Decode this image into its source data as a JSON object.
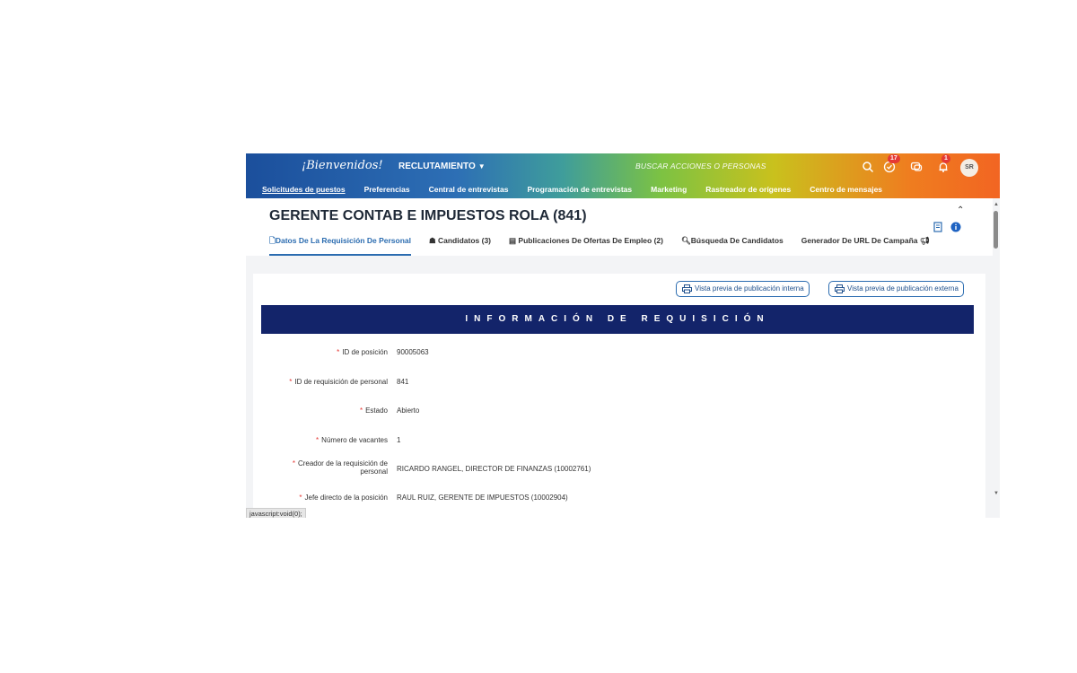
{
  "header": {
    "logo_text": "¡Bienvenidos!",
    "module": "RECLUTAMIENTO",
    "search_placeholder": "BUSCAR ACCIONES O PERSONAS",
    "todo_badge": "17",
    "notifications_badge": "1",
    "avatar": "SR"
  },
  "nav": {
    "items": [
      "Solicitudes de puestos",
      "Preferencias",
      "Central de entrevistas",
      "Programación de entrevistas",
      "Marketing",
      "Rastreador de orígenes",
      "Centro de mensajes"
    ]
  },
  "page": {
    "title": "GERENTE CONTAB E IMPUESTOS ROLA (841)",
    "tabs": [
      "Datos De La Requisición De Personal",
      "Candidatos (3)",
      "Publicaciones De Ofertas De Empleo (2)",
      "Búsqueda De Candidatos",
      "Generador De URL De Campaña"
    ]
  },
  "buttons": {
    "internal_preview": "Vista previa de publicación interna",
    "external_preview": "Vista previa de publicación externa"
  },
  "section_title": "INFORMACIÓN DE REQUISICIÓN",
  "fields": [
    {
      "label": "ID de posición",
      "value": "90005063"
    },
    {
      "label": "ID de requisición de personal",
      "value": "841"
    },
    {
      "label": "Estado",
      "value": "Abierto"
    },
    {
      "label": "Número de vacantes",
      "value": "1"
    },
    {
      "label": "Creador de la requisición de personal",
      "value": "RICARDO RANGEL, DIRECTOR DE FINANZAS (10002761)"
    },
    {
      "label": "Jefe directo de la posición",
      "value": "RAUL RUIZ, GERENTE DE IMPUESTOS (10002904)"
    }
  ],
  "status_bar": "javascript:void(0);",
  "colors": {
    "accent": "#2b6cb0",
    "banner": "#13246a",
    "required": "#e53935"
  }
}
